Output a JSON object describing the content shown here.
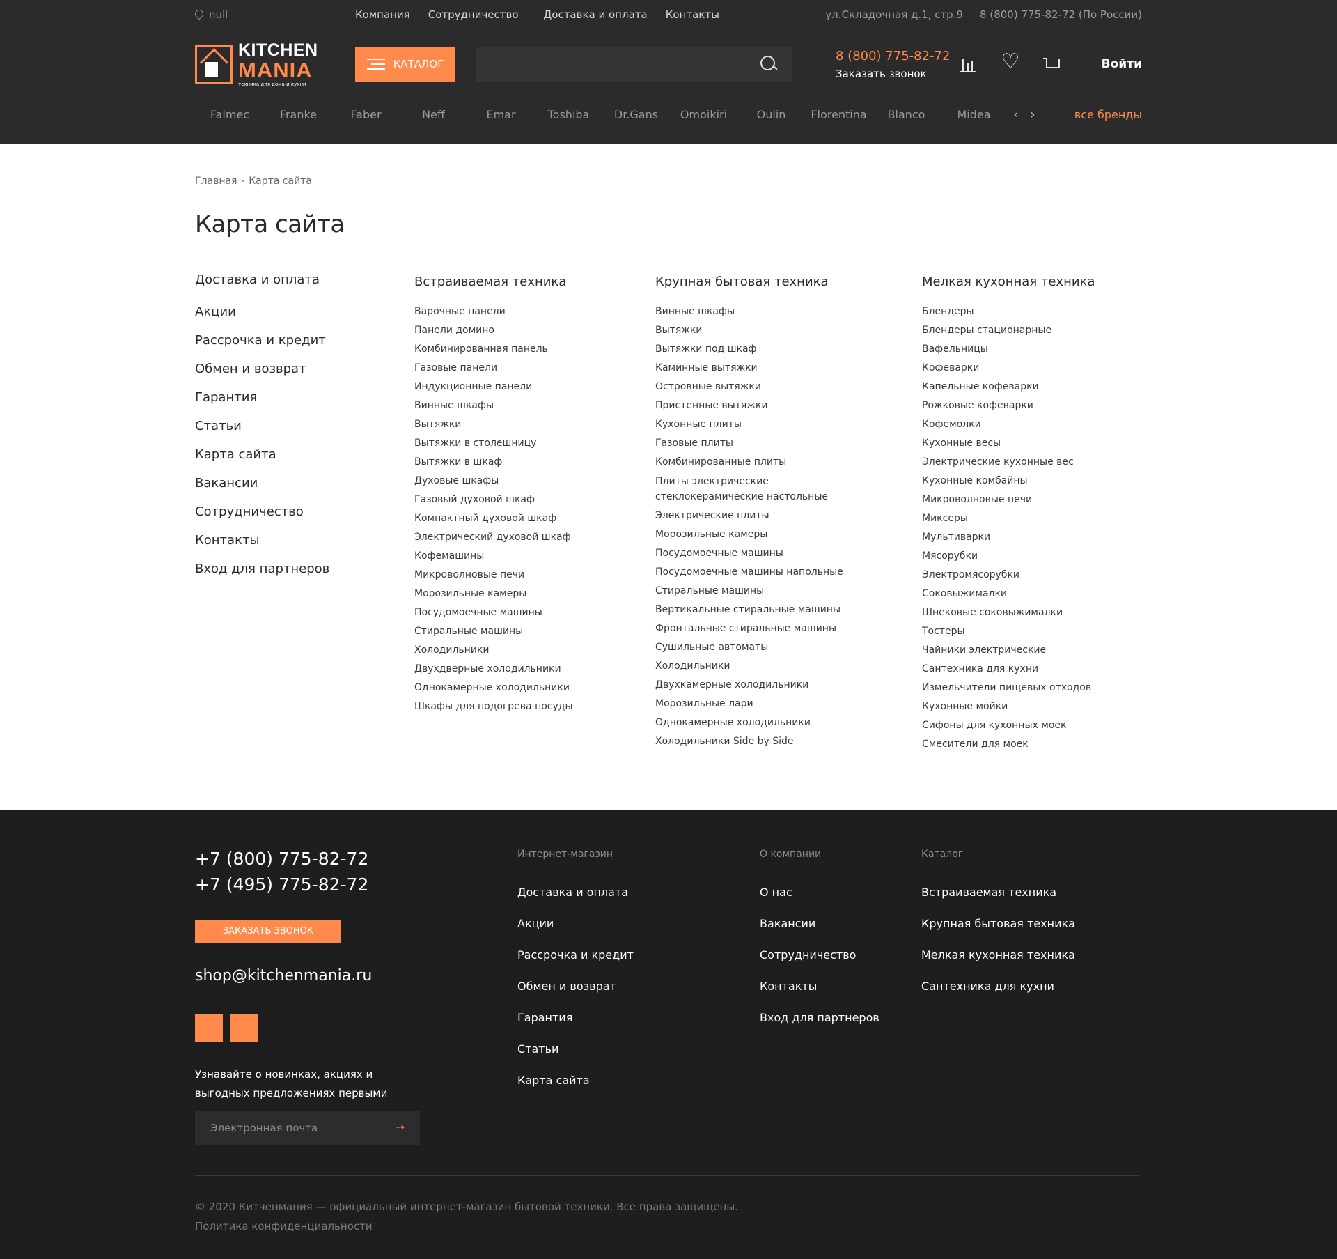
{
  "topbar": {
    "location": "null",
    "nav": [
      "Компания",
      "Сотрудничество",
      "Доставка и оплата",
      "Контакты"
    ],
    "address": "ул.Складочная д.1, стр.9",
    "phone": "8 (800) 775-82-72 (По России)"
  },
  "header": {
    "logo_kitchen": "KITCHEN",
    "logo_mania": "MANIA",
    "logo_tagline": "техника для дома и кухни",
    "catalog_label": "КАТАЛОГ",
    "search_placeholder": "",
    "phone": "8 (800) 775-82-72",
    "callback": "Заказать звонок",
    "login": "Войти"
  },
  "brands": {
    "items": [
      "Falmec",
      "Franke",
      "Faber",
      "Neff",
      "Emar",
      "Toshiba",
      "Dr.Gans",
      "Omoikiri",
      "Oulin",
      "Florentina",
      "Blanco",
      "Midea"
    ],
    "prev": "‹",
    "next": "›",
    "all": "все бренды"
  },
  "breadcrumb": {
    "home": "Главная",
    "current": "Карта сайта"
  },
  "page_title": "Карта сайта",
  "sitemap": {
    "main_links": [
      "Доставка и оплата",
      "Акции",
      "Рассрочка и кредит",
      "Обмен и возврат",
      "Гарантия",
      "Статьи",
      "Карта сайта",
      "Вакансии",
      "Сотрудничество",
      "Контакты",
      "Вход для партнеров"
    ],
    "columns": [
      {
        "title": "Встраиваемая техника",
        "items": [
          "Варочные панели",
          "Панели домино",
          "Комбинированная панель",
          "Газовые панели",
          "Индукционные панели",
          "Винные шкафы",
          "Вытяжки",
          "Вытяжки в столешницу",
          "Вытяжки в шкаф",
          "Духовые шкафы",
          "Газовый духовой шкаф",
          "Компактный духовой шкаф",
          "Электрический духовой шкаф",
          "Кофемашины",
          "Микроволновые печи",
          "Морозильные камеры",
          "Посудомоечные машины",
          "Стиральные машины",
          "Холодильники",
          "Двухдверные холодильники",
          "Однокамерные холодильники",
          "Шкафы для подогрева посуды"
        ]
      },
      {
        "title": "Крупная бытовая техника",
        "items": [
          "Винные шкафы",
          "Вытяжки",
          "Вытяжки под шкаф",
          "Каминные вытяжки",
          "Островные вытяжки",
          "Пристенные вытяжки",
          "Кухонные плиты",
          "Газовые плиты",
          "Комбинированные плиты",
          "Плиты электрические стеклокерамические настольные",
          "Электрические плиты",
          "Морозильные камеры",
          "Посудомоечные машины",
          "Посудомоечные машины напольные",
          "Стиральные машины",
          "Вертикальные стиральные машины",
          "Фронтальные стиральные машины",
          "Сушильные автоматы",
          "Холодильники",
          "Двухкамерные холодильники",
          "Морозильные лари",
          "Однокамерные холодильники",
          "Холодильники Side by Side"
        ]
      },
      {
        "title": "Мелкая кухонная техника",
        "items": [
          "Блендеры",
          "Блендеры стационарные",
          "Вафельницы",
          "Кофеварки",
          "Капельные кофеварки",
          "Рожковые кофеварки",
          "Кофемолки",
          "Кухонные весы",
          "Электрические кухонные вес",
          "Кухонные комбайны",
          "Микроволновые печи",
          "Миксеры",
          "Мультиварки",
          "Мясорубки",
          "Электромясорубки",
          "Соковыжималки",
          "Шнековые соковыжималки",
          "Тостеры",
          "Чайники электрические",
          "Сантехника для кухни",
          "Измельчители пищевых отходов",
          "Кухонные мойки",
          "Сифоны для кухонных моек",
          "Смесители для моек"
        ]
      }
    ]
  },
  "footer": {
    "phones": [
      "+7 (800) 775-82-72",
      "+7 (495) 775-82-72"
    ],
    "callback": "ЗАКАЗАТЬ ЗВОНОК",
    "email": "shop@kitchenmania.ru",
    "newsletter_text": "Узнавайте о новинках, акциях и выгодных предложениях первыми",
    "newsletter_placeholder": "Электронная почта",
    "newsletter_arrow": "→",
    "columns": [
      {
        "title": "Интернет-магазин",
        "links": [
          "Доставка и оплата",
          "Акции",
          "Рассрочка и кредит",
          "Обмен и возврат",
          "Гарантия",
          "Статьи",
          "Карта сайта"
        ]
      },
      {
        "title": "О компании",
        "links": [
          "О нас",
          "Вакансии",
          "Сотрудничество",
          "Контакты",
          "Вход для партнеров"
        ]
      },
      {
        "title": "Каталог",
        "links": [
          "Встраиваемая техника",
          "Крупная бытовая техника",
          "Мелкая кухонная техника",
          "Сантехника для кухни"
        ]
      }
    ],
    "copyright": "© 2020 Китченмания — официальный интернет-магазин бытовой техники. Все права защищены.",
    "privacy": "Политика конфиденциальности"
  },
  "colors": {
    "accent": "#ff8a4c",
    "header_bg": "#2b2b2b",
    "footer_bg": "#1e1e1e"
  }
}
